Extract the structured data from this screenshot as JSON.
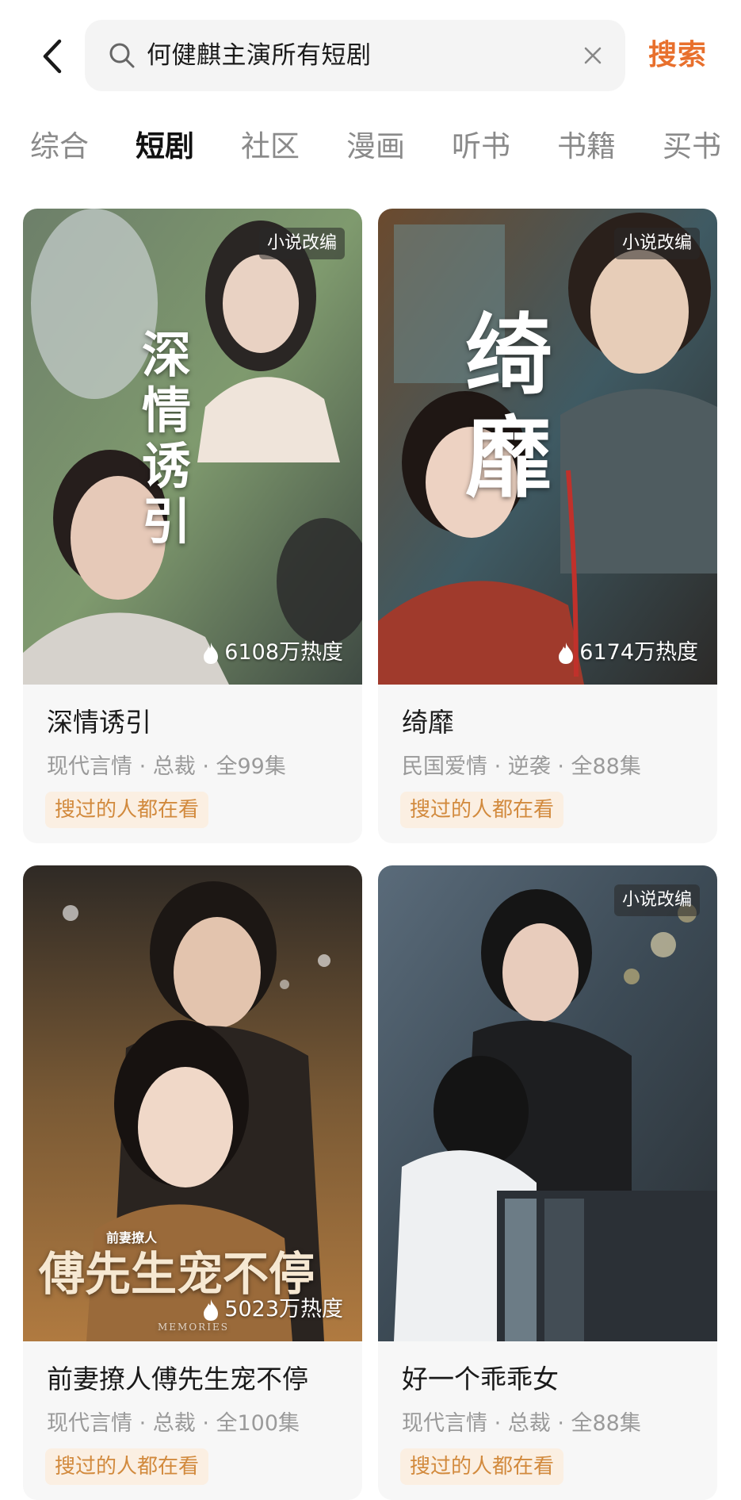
{
  "search": {
    "back_icon": "chevron-left-icon",
    "search_icon": "magnifier-icon",
    "query": "何健麒主演所有短剧",
    "clear_icon": "close-icon",
    "button_label": "搜索",
    "accent_color": "#e8702d"
  },
  "tabs": [
    {
      "label": "综合",
      "active": false
    },
    {
      "label": "短剧",
      "active": true
    },
    {
      "label": "社区",
      "active": false
    },
    {
      "label": "漫画",
      "active": false
    },
    {
      "label": "听书",
      "active": false
    },
    {
      "label": "书籍",
      "active": false
    },
    {
      "label": "买书",
      "active": false
    }
  ],
  "cards": [
    {
      "tag": "小说改编",
      "heat": "6108万热度",
      "title": "深情诱引",
      "meta": "现代言情 · 总裁 · 全99集",
      "badge": "搜过的人都在看",
      "poster_text": "深情诱引"
    },
    {
      "tag": "小说改编",
      "heat": "6174万热度",
      "title": "绮靡",
      "meta": "民国爱情 · 逆袭 · 全88集",
      "badge": "搜过的人都在看",
      "poster_text": "绮靡"
    },
    {
      "tag": "",
      "heat": "5023万热度",
      "title": "前妻撩人傅先生宠不停",
      "meta": "现代言情 · 总裁 · 全100集",
      "badge": "搜过的人都在看",
      "poster_text": "傅先生宠不停",
      "poster_subtext": "前妻撩人",
      "poster_small": "MEMORIES"
    },
    {
      "tag": "小说改编",
      "heat": "",
      "title": "好一个乖乖女",
      "meta": "现代言情 · 总裁 · 全88集",
      "badge": "搜过的人都在看"
    }
  ],
  "colors": {
    "badge_text": "#d28a3d",
    "badge_bg": "#fbefe2",
    "card_bg": "#f7f7f7"
  }
}
